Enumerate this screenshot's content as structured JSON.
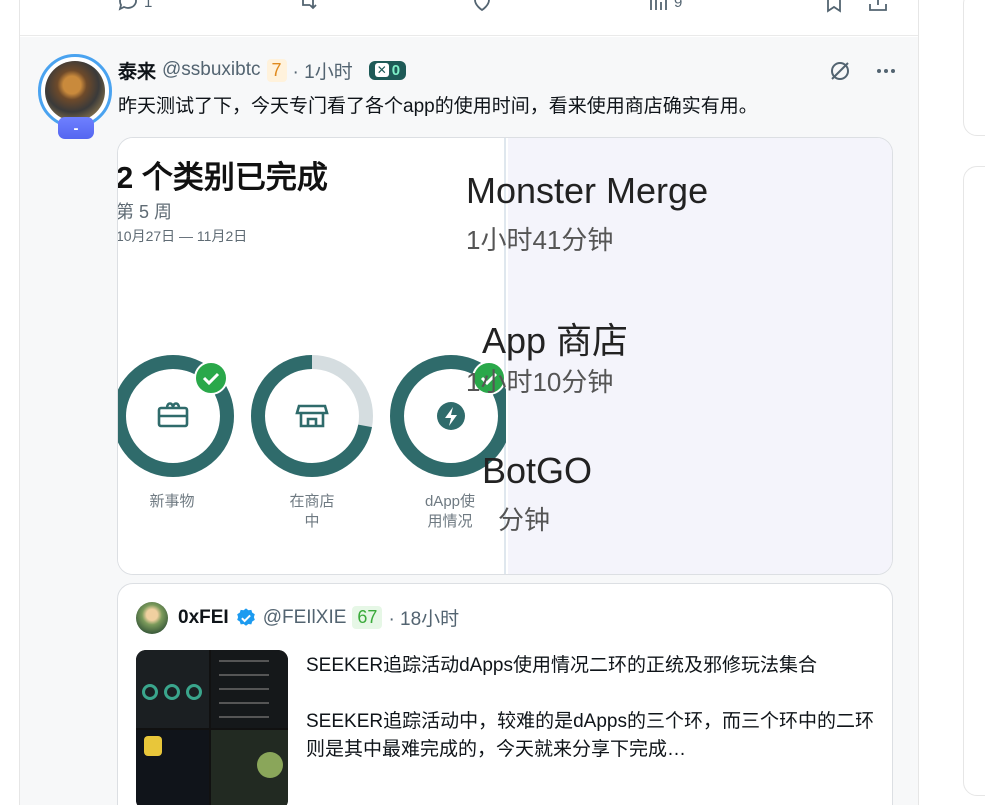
{
  "prev_post": {
    "reply_count": "1",
    "views_count": "9"
  },
  "post": {
    "display_name": "泰来",
    "handle": "@ssbuxibtc",
    "score": "7",
    "time": "· 1小时",
    "chip_count": "0",
    "avatar_badge": "-",
    "text": "昨天测试了下，今天专门看了各个app的使用时间，看来使用商店确实有用。",
    "media": {
      "title": "2 个类别已完成",
      "week": "第 5 周",
      "date_range": "10月27日 — 11月2日",
      "rings": [
        {
          "label": "新事物",
          "progress": 1.0,
          "complete": true,
          "icon": "gift-card-icon"
        },
        {
          "label": "在商店中",
          "progress": 0.72,
          "complete": false,
          "icon": "store-icon"
        },
        {
          "label": "dApp使用情况",
          "progress": 1.0,
          "complete": true,
          "icon": "bolt-icon"
        }
      ],
      "ring_colors": {
        "track": "#d5dde0",
        "fill": "#2f6b6b",
        "check": "#2aa84a"
      },
      "apps": [
        {
          "name": "Monster Merge",
          "duration": "1小时41分钟"
        },
        {
          "name": "App 商店",
          "duration": "1小时10分钟"
        },
        {
          "name": "BotGO",
          "duration": "分钟"
        }
      ]
    }
  },
  "quote": {
    "display_name": "0xFEI",
    "handle": "@FEIlXIE",
    "score": "67",
    "time": "· 18小时",
    "title": "SEEKER追踪活动dApps使用情况二环的正统及邪修玩法集合",
    "body": "SEEKER追踪活动中，较难的是dApps的三个环，而三个环中的二环则是其中最难完成的，今天就来分享下完成…"
  }
}
